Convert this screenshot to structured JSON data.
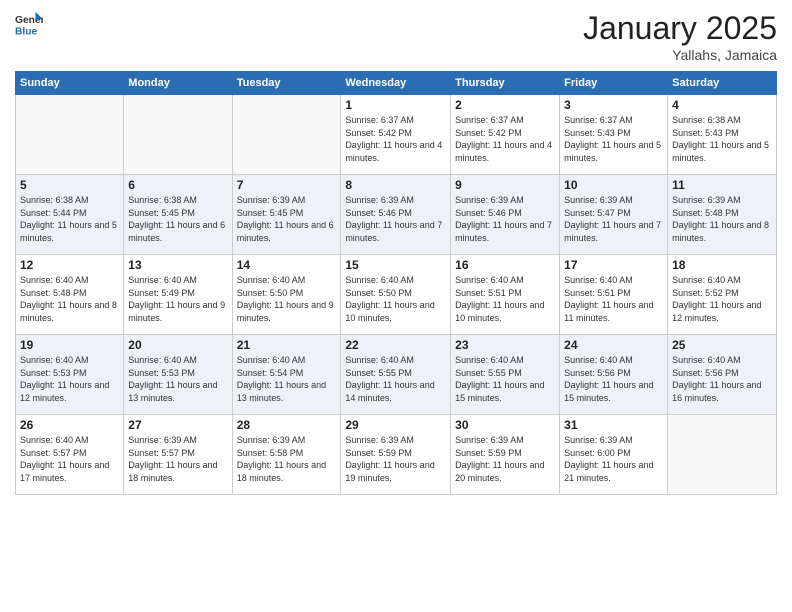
{
  "header": {
    "logo_general": "General",
    "logo_blue": "Blue",
    "month_title": "January 2025",
    "subtitle": "Yallahs, Jamaica"
  },
  "weekdays": [
    "Sunday",
    "Monday",
    "Tuesday",
    "Wednesday",
    "Thursday",
    "Friday",
    "Saturday"
  ],
  "weeks": [
    [
      {
        "day": "",
        "info": ""
      },
      {
        "day": "",
        "info": ""
      },
      {
        "day": "",
        "info": ""
      },
      {
        "day": "1",
        "info": "Sunrise: 6:37 AM\nSunset: 5:42 PM\nDaylight: 11 hours\nand 4 minutes."
      },
      {
        "day": "2",
        "info": "Sunrise: 6:37 AM\nSunset: 5:42 PM\nDaylight: 11 hours\nand 4 minutes."
      },
      {
        "day": "3",
        "info": "Sunrise: 6:37 AM\nSunset: 5:43 PM\nDaylight: 11 hours\nand 5 minutes."
      },
      {
        "day": "4",
        "info": "Sunrise: 6:38 AM\nSunset: 5:43 PM\nDaylight: 11 hours\nand 5 minutes."
      }
    ],
    [
      {
        "day": "5",
        "info": "Sunrise: 6:38 AM\nSunset: 5:44 PM\nDaylight: 11 hours\nand 5 minutes."
      },
      {
        "day": "6",
        "info": "Sunrise: 6:38 AM\nSunset: 5:45 PM\nDaylight: 11 hours\nand 6 minutes."
      },
      {
        "day": "7",
        "info": "Sunrise: 6:39 AM\nSunset: 5:45 PM\nDaylight: 11 hours\nand 6 minutes."
      },
      {
        "day": "8",
        "info": "Sunrise: 6:39 AM\nSunset: 5:46 PM\nDaylight: 11 hours\nand 7 minutes."
      },
      {
        "day": "9",
        "info": "Sunrise: 6:39 AM\nSunset: 5:46 PM\nDaylight: 11 hours\nand 7 minutes."
      },
      {
        "day": "10",
        "info": "Sunrise: 6:39 AM\nSunset: 5:47 PM\nDaylight: 11 hours\nand 7 minutes."
      },
      {
        "day": "11",
        "info": "Sunrise: 6:39 AM\nSunset: 5:48 PM\nDaylight: 11 hours\nand 8 minutes."
      }
    ],
    [
      {
        "day": "12",
        "info": "Sunrise: 6:40 AM\nSunset: 5:48 PM\nDaylight: 11 hours\nand 8 minutes."
      },
      {
        "day": "13",
        "info": "Sunrise: 6:40 AM\nSunset: 5:49 PM\nDaylight: 11 hours\nand 9 minutes."
      },
      {
        "day": "14",
        "info": "Sunrise: 6:40 AM\nSunset: 5:50 PM\nDaylight: 11 hours\nand 9 minutes."
      },
      {
        "day": "15",
        "info": "Sunrise: 6:40 AM\nSunset: 5:50 PM\nDaylight: 11 hours\nand 10 minutes."
      },
      {
        "day": "16",
        "info": "Sunrise: 6:40 AM\nSunset: 5:51 PM\nDaylight: 11 hours\nand 10 minutes."
      },
      {
        "day": "17",
        "info": "Sunrise: 6:40 AM\nSunset: 5:51 PM\nDaylight: 11 hours\nand 11 minutes."
      },
      {
        "day": "18",
        "info": "Sunrise: 6:40 AM\nSunset: 5:52 PM\nDaylight: 11 hours\nand 12 minutes."
      }
    ],
    [
      {
        "day": "19",
        "info": "Sunrise: 6:40 AM\nSunset: 5:53 PM\nDaylight: 11 hours\nand 12 minutes."
      },
      {
        "day": "20",
        "info": "Sunrise: 6:40 AM\nSunset: 5:53 PM\nDaylight: 11 hours\nand 13 minutes."
      },
      {
        "day": "21",
        "info": "Sunrise: 6:40 AM\nSunset: 5:54 PM\nDaylight: 11 hours\nand 13 minutes."
      },
      {
        "day": "22",
        "info": "Sunrise: 6:40 AM\nSunset: 5:55 PM\nDaylight: 11 hours\nand 14 minutes."
      },
      {
        "day": "23",
        "info": "Sunrise: 6:40 AM\nSunset: 5:55 PM\nDaylight: 11 hours\nand 15 minutes."
      },
      {
        "day": "24",
        "info": "Sunrise: 6:40 AM\nSunset: 5:56 PM\nDaylight: 11 hours\nand 15 minutes."
      },
      {
        "day": "25",
        "info": "Sunrise: 6:40 AM\nSunset: 5:56 PM\nDaylight: 11 hours\nand 16 minutes."
      }
    ],
    [
      {
        "day": "26",
        "info": "Sunrise: 6:40 AM\nSunset: 5:57 PM\nDaylight: 11 hours\nand 17 minutes."
      },
      {
        "day": "27",
        "info": "Sunrise: 6:39 AM\nSunset: 5:57 PM\nDaylight: 11 hours\nand 18 minutes."
      },
      {
        "day": "28",
        "info": "Sunrise: 6:39 AM\nSunset: 5:58 PM\nDaylight: 11 hours\nand 18 minutes."
      },
      {
        "day": "29",
        "info": "Sunrise: 6:39 AM\nSunset: 5:59 PM\nDaylight: 11 hours\nand 19 minutes."
      },
      {
        "day": "30",
        "info": "Sunrise: 6:39 AM\nSunset: 5:59 PM\nDaylight: 11 hours\nand 20 minutes."
      },
      {
        "day": "31",
        "info": "Sunrise: 6:39 AM\nSunset: 6:00 PM\nDaylight: 11 hours\nand 21 minutes."
      },
      {
        "day": "",
        "info": ""
      }
    ]
  ]
}
